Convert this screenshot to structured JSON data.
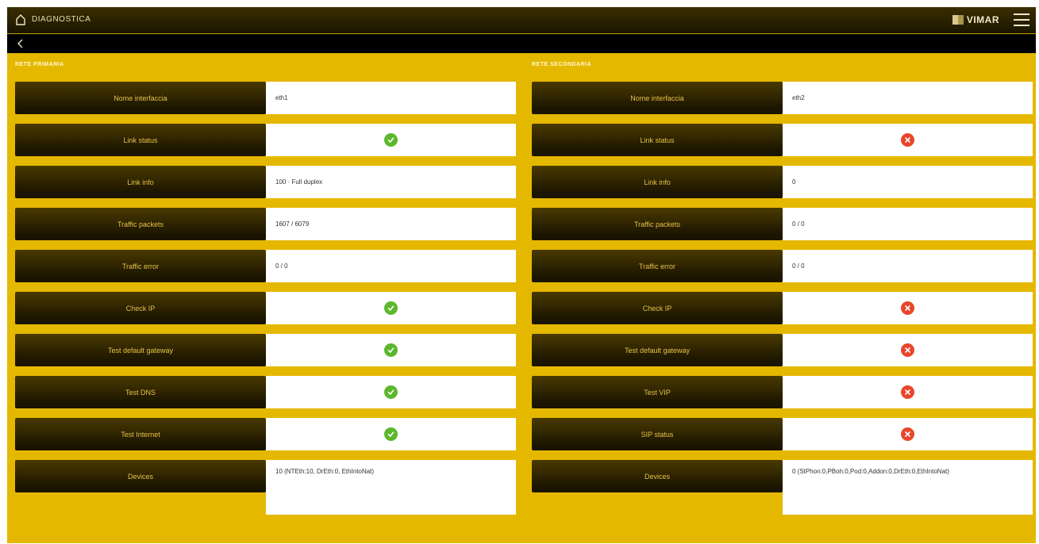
{
  "header": {
    "title": "DIAGNOSTICA",
    "brand": "VIMAR",
    "home_icon": "home-icon",
    "menu_icon": "hamburger-menu-icon",
    "back_icon": "chevron-left-icon"
  },
  "colors": {
    "background": "#e5b800",
    "label_text": "#e6c24a",
    "ok": "#5cb72d",
    "error": "#e8462c"
  },
  "left": {
    "section_title": "RETE PRIMARIA",
    "rows": [
      {
        "label": "Nome interfaccia",
        "value": "eth1"
      },
      {
        "label": "Link status",
        "status": "ok"
      },
      {
        "label": "Link info",
        "value": "100 · Full duplex"
      },
      {
        "label": "Traffic packets",
        "value": "1607 / 6079"
      },
      {
        "label": "Traffic error",
        "value": "0 / 0"
      },
      {
        "label": "Check IP",
        "status": "ok"
      },
      {
        "label": "Test default gateway",
        "status": "ok"
      },
      {
        "label": "Test DNS",
        "status": "ok"
      },
      {
        "label": "Test Internet",
        "status": "ok"
      },
      {
        "label": "Devices",
        "value": "10 (NTEth:10, DrEth:0, EthIntoNat)"
      }
    ]
  },
  "right": {
    "section_title": "RETE SECONDARIA",
    "rows": [
      {
        "label": "Nome interfaccia",
        "value": "eth2"
      },
      {
        "label": "Link status",
        "status": "error"
      },
      {
        "label": "Link info",
        "value": "0"
      },
      {
        "label": "Traffic packets",
        "value": "0 / 0"
      },
      {
        "label": "Traffic error",
        "value": "0 / 0"
      },
      {
        "label": "Check IP",
        "status": "error"
      },
      {
        "label": "Test default gateway",
        "status": "error"
      },
      {
        "label": "Test VIP",
        "status": "error"
      },
      {
        "label": "SIP status",
        "status": "error"
      },
      {
        "label": "Devices",
        "value": "0 (StPhon:0,PBoh:0,Pod:0,Addon:0,DrEth:0,EthIntoNat)"
      }
    ]
  }
}
